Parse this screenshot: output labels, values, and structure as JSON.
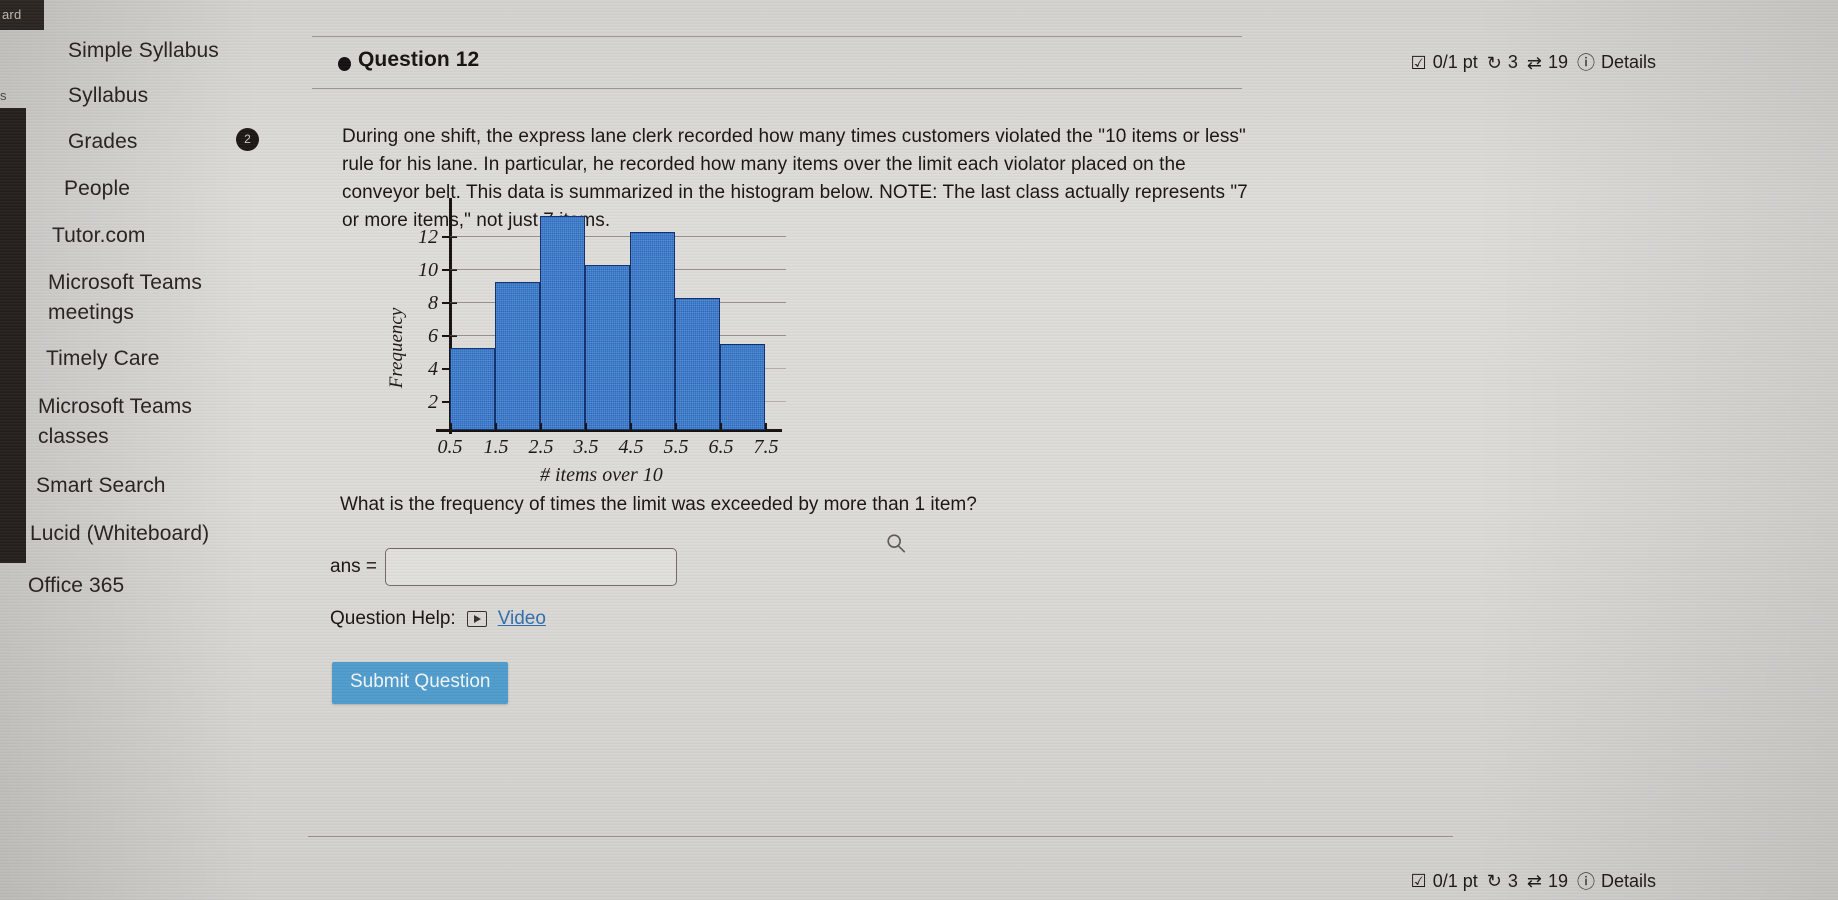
{
  "rail": {
    "top_fragment": "ard",
    "side_glyph": "s"
  },
  "sidebar": {
    "items": [
      {
        "label": "Simple Syllabus",
        "badge": null
      },
      {
        "label": "Syllabus",
        "badge": null
      },
      {
        "label": "Grades",
        "badge": "2"
      },
      {
        "label": "People",
        "badge": null
      },
      {
        "label": "Tutor.com",
        "badge": null
      },
      {
        "label": "Microsoft Teams\nmeetings",
        "badge": null
      },
      {
        "label": "Timely Care",
        "badge": null
      },
      {
        "label": "Microsoft Teams\nclasses",
        "badge": null
      },
      {
        "label": "Smart Search",
        "badge": null
      },
      {
        "label": "Lucid (Whiteboard)",
        "badge": null
      },
      {
        "label": "Office 365",
        "badge": null
      }
    ]
  },
  "question": {
    "title": "Question 12",
    "points": "0/1 pt",
    "attempts": "3",
    "exchanges": "19",
    "details_label": "Details",
    "icons": {
      "checkbox": "checkbox-icon",
      "retry": "retry-icon",
      "shuffle": "exchange-icon",
      "info": "info-icon"
    },
    "body": "During one shift, the express lane clerk recorded how many times customers violated the \"10 items or less\" rule for his lane. In particular, he recorded how many items over the limit each violator placed on the conveyor belt. This data is summarized in the histogram below. NOTE: The last class actually represents \"7 or more items,\" not just 7 items.",
    "prompt": "What is the frequency of times the limit was exceeded by more than 1 item?",
    "answer_label": "ans =",
    "answer_value": "",
    "answer_placeholder": "",
    "help_label": "Question Help:",
    "help_video_label": "Video",
    "submit_label": "Submit Question"
  },
  "bottom_question": {
    "points": "0/1 pt",
    "attempts": "3",
    "exchanges": "19",
    "details_label": "Details"
  },
  "chart_data": {
    "type": "bar",
    "title": "",
    "xlabel": "# items over 10",
    "ylabel": "Frequency",
    "categories": [
      "0.5-1.5",
      "1.5-2.5",
      "2.5-3.5",
      "3.5-4.5",
      "4.5-5.5",
      "5.5-6.5",
      "6.5-7.5"
    ],
    "bin_edges": [
      "0.5",
      "1.5",
      "2.5",
      "3.5",
      "4.5",
      "5.5",
      "6.5",
      "7.5"
    ],
    "values": [
      5,
      9,
      13,
      10,
      12,
      8,
      5
    ],
    "ytick_labels": [
      "12",
      "10",
      "8",
      "6",
      "4",
      "2"
    ],
    "yticks": [
      12,
      10,
      8,
      6,
      4,
      2
    ],
    "ylim": [
      0,
      13.6
    ],
    "grid": true,
    "legend": "none",
    "bar_color": "#2a6dc4",
    "bar_edge_color": "#10306b"
  },
  "colors": {
    "page_bg": "#dedcd8",
    "accent_blue": "#4f9ccd",
    "link_blue": "#2f6fb0",
    "bar_blue": "#2a6dc4",
    "text": "#181412",
    "rail_dark": "#241f1c"
  }
}
